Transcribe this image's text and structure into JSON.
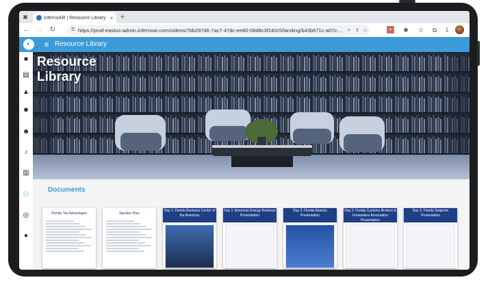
{
  "browser": {
    "tab_title": "InfernoAR | Resource Library",
    "tab_close": "×",
    "new_tab": "+",
    "url": "https://prod-eastus-admin.infernoar.com/videos/7bb297d6-7ac7-47dc-ee80-08d8c3f240c5/landing/b43b671c-a07c-..."
  },
  "app": {
    "title": "Resource Library",
    "accent_color": "#3c9ad8"
  },
  "sidebar": {
    "items": [
      {
        "icon": "video-camera-icon"
      },
      {
        "icon": "store-icon"
      },
      {
        "icon": "stage-icon"
      },
      {
        "icon": "gear-icon"
      },
      {
        "icon": "people-icon"
      },
      {
        "icon": "microphone-icon"
      },
      {
        "icon": "building-icon"
      },
      {
        "icon": "globe-people-icon",
        "active": true
      },
      {
        "icon": "support-icon"
      },
      {
        "icon": "info-icon"
      }
    ]
  },
  "hero": {
    "title_line1": "Resource",
    "title_line2": "Library"
  },
  "documents": {
    "heading": "Documents",
    "cards": [
      {
        "title": "Florida Tax Advantages",
        "bar_color": "#ffffff",
        "text_color": "#2a3a63"
      },
      {
        "title": "Speaker Bios",
        "bar_color": "#ffffff",
        "text_color": "#2a3a63"
      },
      {
        "title": "Day 1: Florida Business Center of the Americas",
        "bar_color": "#1e3f86",
        "text_color": "#ffffff"
      },
      {
        "title": "Day 1: American Energy Business Presentation",
        "bar_color": "#1e3f86",
        "text_color": "#ffffff"
      },
      {
        "title": "Day 2: Florida Airports Presentation",
        "bar_color": "#1e3f86",
        "text_color": "#ffffff"
      },
      {
        "title": "Day 2: Florida Customs Brokers & Forwarders Association Presentation",
        "bar_color": "#1e3f86",
        "text_color": "#ffffff"
      },
      {
        "title": "Day 3: Florida Seaports Presentation",
        "bar_color": "#1e3f86",
        "text_color": "#ffffff"
      }
    ]
  }
}
